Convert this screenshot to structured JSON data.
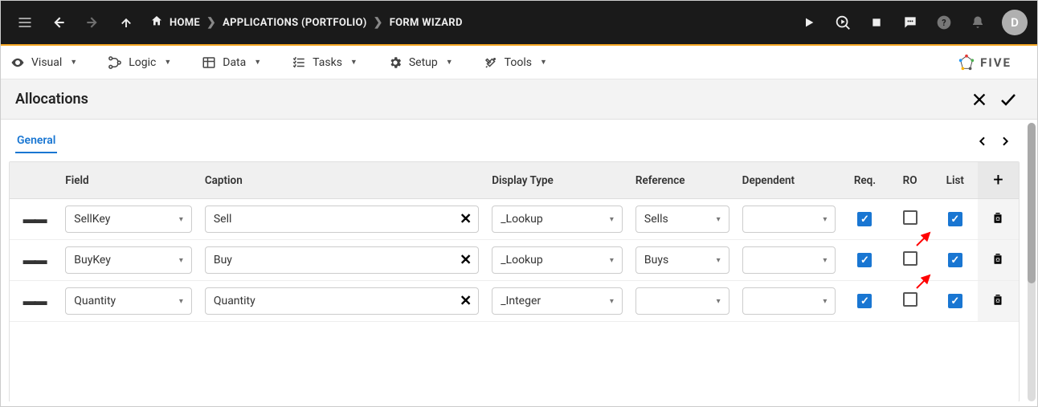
{
  "topbar": {
    "breadcrumb": [
      {
        "label": "HOME",
        "icon": "home"
      },
      {
        "label": "APPLICATIONS (PORTFOLIO)"
      },
      {
        "label": "FORM WIZARD"
      }
    ],
    "avatar": "D"
  },
  "toolbar": {
    "items": [
      {
        "label": "Visual",
        "icon": "eye"
      },
      {
        "label": "Logic",
        "icon": "branch"
      },
      {
        "label": "Data",
        "icon": "table"
      },
      {
        "label": "Tasks",
        "icon": "list"
      },
      {
        "label": "Setup",
        "icon": "gear"
      },
      {
        "label": "Tools",
        "icon": "wrench"
      }
    ],
    "brand": "FIVE"
  },
  "page": {
    "title": "Allocations"
  },
  "tabs": {
    "active": "General"
  },
  "grid": {
    "headers": {
      "field": "Field",
      "caption": "Caption",
      "display": "Display Type",
      "reference": "Reference",
      "dependent": "Dependent",
      "req": "Req.",
      "ro": "RO",
      "list": "List"
    },
    "rows": [
      {
        "field": "SellKey",
        "caption": "Sell",
        "display": "_Lookup",
        "reference": "Sells",
        "dependent": "",
        "req": true,
        "ro": false,
        "list": true
      },
      {
        "field": "BuyKey",
        "caption": "Buy",
        "display": "_Lookup",
        "reference": "Buys",
        "dependent": "",
        "req": true,
        "ro": false,
        "list": true
      },
      {
        "field": "Quantity",
        "caption": "Quantity",
        "display": "_Integer",
        "reference": "",
        "dependent": "",
        "req": true,
        "ro": false,
        "list": true
      }
    ]
  },
  "colors": {
    "accent": "#1976d2",
    "accent_bar": "#f5a623"
  }
}
